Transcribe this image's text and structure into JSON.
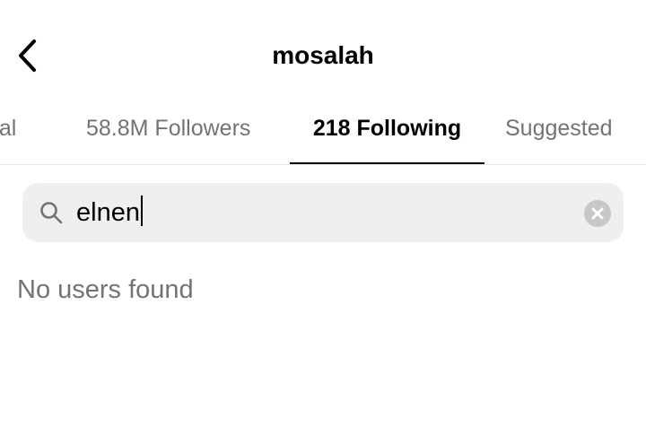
{
  "header": {
    "title": "mosalah",
    "back_icon": "chevron-left-icon"
  },
  "tabs": [
    {
      "label": "tual",
      "active": false
    },
    {
      "label": "58.8M Followers",
      "active": false
    },
    {
      "label": "218 Following",
      "active": true
    },
    {
      "label": "Suggested",
      "active": false
    }
  ],
  "search": {
    "value": "elnen",
    "icon": "search-icon",
    "clear_icon": "clear-icon"
  },
  "results": {
    "empty_message": "No users found"
  },
  "colors": {
    "primary_text": "#000000",
    "secondary_text": "#737373",
    "search_bg": "#efefef",
    "divider": "#e6e6e6"
  }
}
